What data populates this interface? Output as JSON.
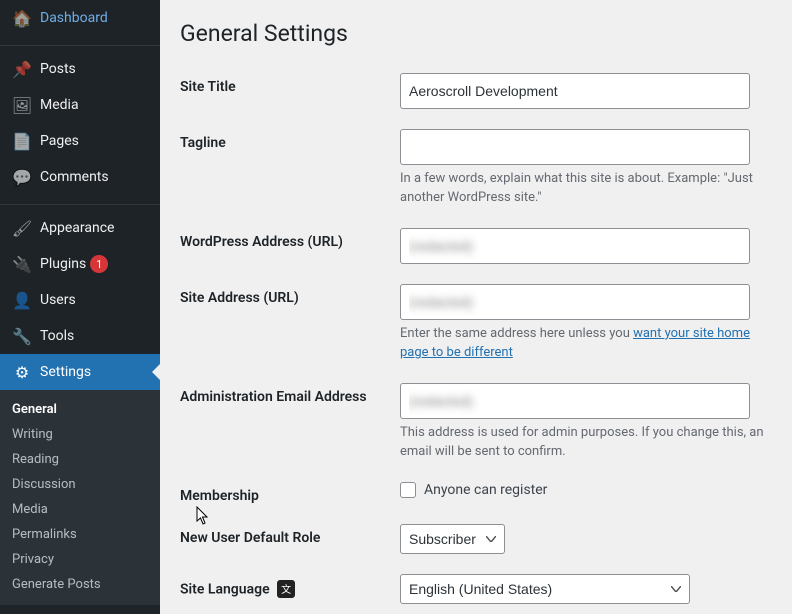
{
  "sidebar": {
    "items": [
      {
        "label": "Dashboard",
        "icon": "🏠"
      },
      {
        "label": "Posts",
        "icon": "📌"
      },
      {
        "label": "Media",
        "icon": "🖼"
      },
      {
        "label": "Pages",
        "icon": "📄"
      },
      {
        "label": "Comments",
        "icon": "💬"
      },
      {
        "label": "Appearance",
        "icon": "🖌"
      },
      {
        "label": "Plugins",
        "icon": "🔌",
        "badge": "1"
      },
      {
        "label": "Users",
        "icon": "👤"
      },
      {
        "label": "Tools",
        "icon": "🔧"
      },
      {
        "label": "Settings",
        "icon": "⚙"
      }
    ],
    "submenu": [
      {
        "label": "General",
        "active": true
      },
      {
        "label": "Writing"
      },
      {
        "label": "Reading"
      },
      {
        "label": "Discussion"
      },
      {
        "label": "Media"
      },
      {
        "label": "Permalinks"
      },
      {
        "label": "Privacy"
      },
      {
        "label": "Generate Posts"
      }
    ]
  },
  "page": {
    "title": "General Settings",
    "labels": {
      "site_title": "Site Title",
      "tagline": "Tagline",
      "wp_address": "WordPress Address (URL)",
      "site_address": "Site Address (URL)",
      "admin_email": "Administration Email Address",
      "membership": "Membership",
      "default_role": "New User Default Role",
      "site_language": "Site Language"
    },
    "values": {
      "site_title": "Aeroscroll Development",
      "tagline": "",
      "wp_address": "(redacted)",
      "site_address": "(redacted)",
      "admin_email": "(redacted)",
      "membership_checkbox_label": "Anyone can register",
      "membership_checked": false,
      "default_role": "Subscriber",
      "site_language": "English (United States)"
    },
    "descriptions": {
      "tagline": "In a few words, explain what this site is about. Example: \"Just another WordPress site.\"",
      "site_address_text": "Enter the same address here unless you ",
      "site_address_link": "want your site home page to be different",
      "admin_email": "This address is used for admin purposes. If you change this, an email will be sent to confirm."
    }
  }
}
